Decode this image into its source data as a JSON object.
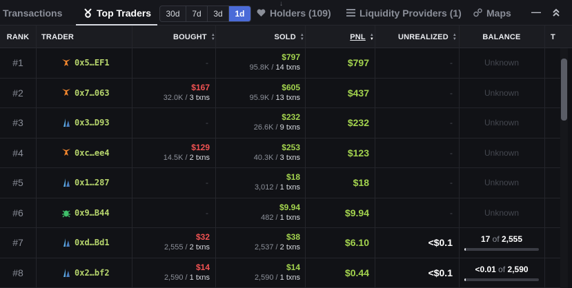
{
  "tabs": {
    "transactions": "Transactions",
    "top_traders": "Top Traders",
    "holders": "Holders (109)",
    "liquidity": "Liquidity Providers (1)",
    "maps": "Maps",
    "minimize": "—",
    "collapse": "⌃"
  },
  "periods": [
    {
      "label": "30d",
      "active": false
    },
    {
      "label": "7d",
      "active": false
    },
    {
      "label": "3d",
      "active": false
    },
    {
      "label": "1d",
      "active": true
    }
  ],
  "columns": {
    "rank": "RANK",
    "trader": "TRADER",
    "bought": "BOUGHT",
    "sold": "SOLD",
    "pnl": "PNL",
    "unrealized": "UNREALIZED",
    "balance": "BALANCE",
    "extra": "T"
  },
  "colors": {
    "accent": "#4b6bd8",
    "positive": "#a3d34e",
    "negative": "#f05252"
  },
  "rows": [
    {
      "rank": "#1",
      "icon": "metamask-fox-icon",
      "address": "0x5…EF1",
      "bought_amt": "",
      "bought_sub": "-",
      "bought_txns": "",
      "sold_amt": "$797",
      "sold_sub": "95.8K / ",
      "sold_txns": "14 txns",
      "pnl": "$797",
      "unrealized": "-",
      "balance": "Unknown",
      "bal_have": "",
      "bal_of": "",
      "bal_total": "",
      "bal_fill": 0
    },
    {
      "rank": "#2",
      "icon": "metamask-fox-icon",
      "address": "0x7…063",
      "bought_amt": "$167",
      "bought_sub": "32.0K / ",
      "bought_txns": "3 txns",
      "sold_amt": "$605",
      "sold_sub": "95.9K / ",
      "sold_txns": "13 txns",
      "pnl": "$437",
      "unrealized": "-",
      "balance": "Unknown",
      "bal_have": "",
      "bal_of": "",
      "bal_total": "",
      "bal_fill": 0
    },
    {
      "rank": "#3",
      "icon": "sail-icon",
      "address": "0x3…D93",
      "bought_amt": "",
      "bought_sub": "-",
      "bought_txns": "",
      "sold_amt": "$232",
      "sold_sub": "26.6K / ",
      "sold_txns": "9 txns",
      "pnl": "$232",
      "unrealized": "-",
      "balance": "Unknown",
      "bal_have": "",
      "bal_of": "",
      "bal_total": "",
      "bal_fill": 0
    },
    {
      "rank": "#4",
      "icon": "metamask-fox-icon",
      "address": "0xc…ee4",
      "bought_amt": "$129",
      "bought_sub": "14.5K / ",
      "bought_txns": "2 txns",
      "sold_amt": "$253",
      "sold_sub": "40.3K / ",
      "sold_txns": "3 txns",
      "pnl": "$123",
      "unrealized": "-",
      "balance": "Unknown",
      "bal_have": "",
      "bal_of": "",
      "bal_total": "",
      "bal_fill": 0
    },
    {
      "rank": "#5",
      "icon": "sail-icon",
      "address": "0x1…287",
      "bought_amt": "",
      "bought_sub": "-",
      "bought_txns": "",
      "sold_amt": "$18",
      "sold_sub": "3,012 / ",
      "sold_txns": "1 txns",
      "pnl": "$18",
      "unrealized": "-",
      "balance": "Unknown",
      "bal_have": "",
      "bal_of": "",
      "bal_total": "",
      "bal_fill": 0
    },
    {
      "rank": "#6",
      "icon": "bug-icon",
      "address": "0x9…B44",
      "bought_amt": "",
      "bought_sub": "-",
      "bought_txns": "",
      "sold_amt": "$9.94",
      "sold_sub": "482 / ",
      "sold_txns": "1 txns",
      "pnl": "$9.94",
      "unrealized": "-",
      "balance": "Unknown",
      "bal_have": "",
      "bal_of": "",
      "bal_total": "",
      "bal_fill": 0
    },
    {
      "rank": "#7",
      "icon": "sail-icon",
      "address": "0xd…Bd1",
      "bought_amt": "$32",
      "bought_sub": "2,555 / ",
      "bought_txns": "2 txns",
      "sold_amt": "$38",
      "sold_sub": "2,537 / ",
      "sold_txns": "2 txns",
      "pnl": "$6.10",
      "unrealized": "<$0.1",
      "balance": "",
      "bal_have": "17",
      "bal_of": " of ",
      "bal_total": "2,555",
      "bal_fill": 0.01
    },
    {
      "rank": "#8",
      "icon": "sail-icon",
      "address": "0x2…bf2",
      "bought_amt": "$14",
      "bought_sub": "2,590 / ",
      "bought_txns": "1 txns",
      "sold_amt": "$14",
      "sold_sub": "2,590 / ",
      "sold_txns": "1 txns",
      "pnl": "$0.44",
      "unrealized": "<$0.1",
      "balance": "",
      "bal_have": "<0.01",
      "bal_of": " of ",
      "bal_total": "2,590",
      "bal_fill": 0.0
    }
  ]
}
